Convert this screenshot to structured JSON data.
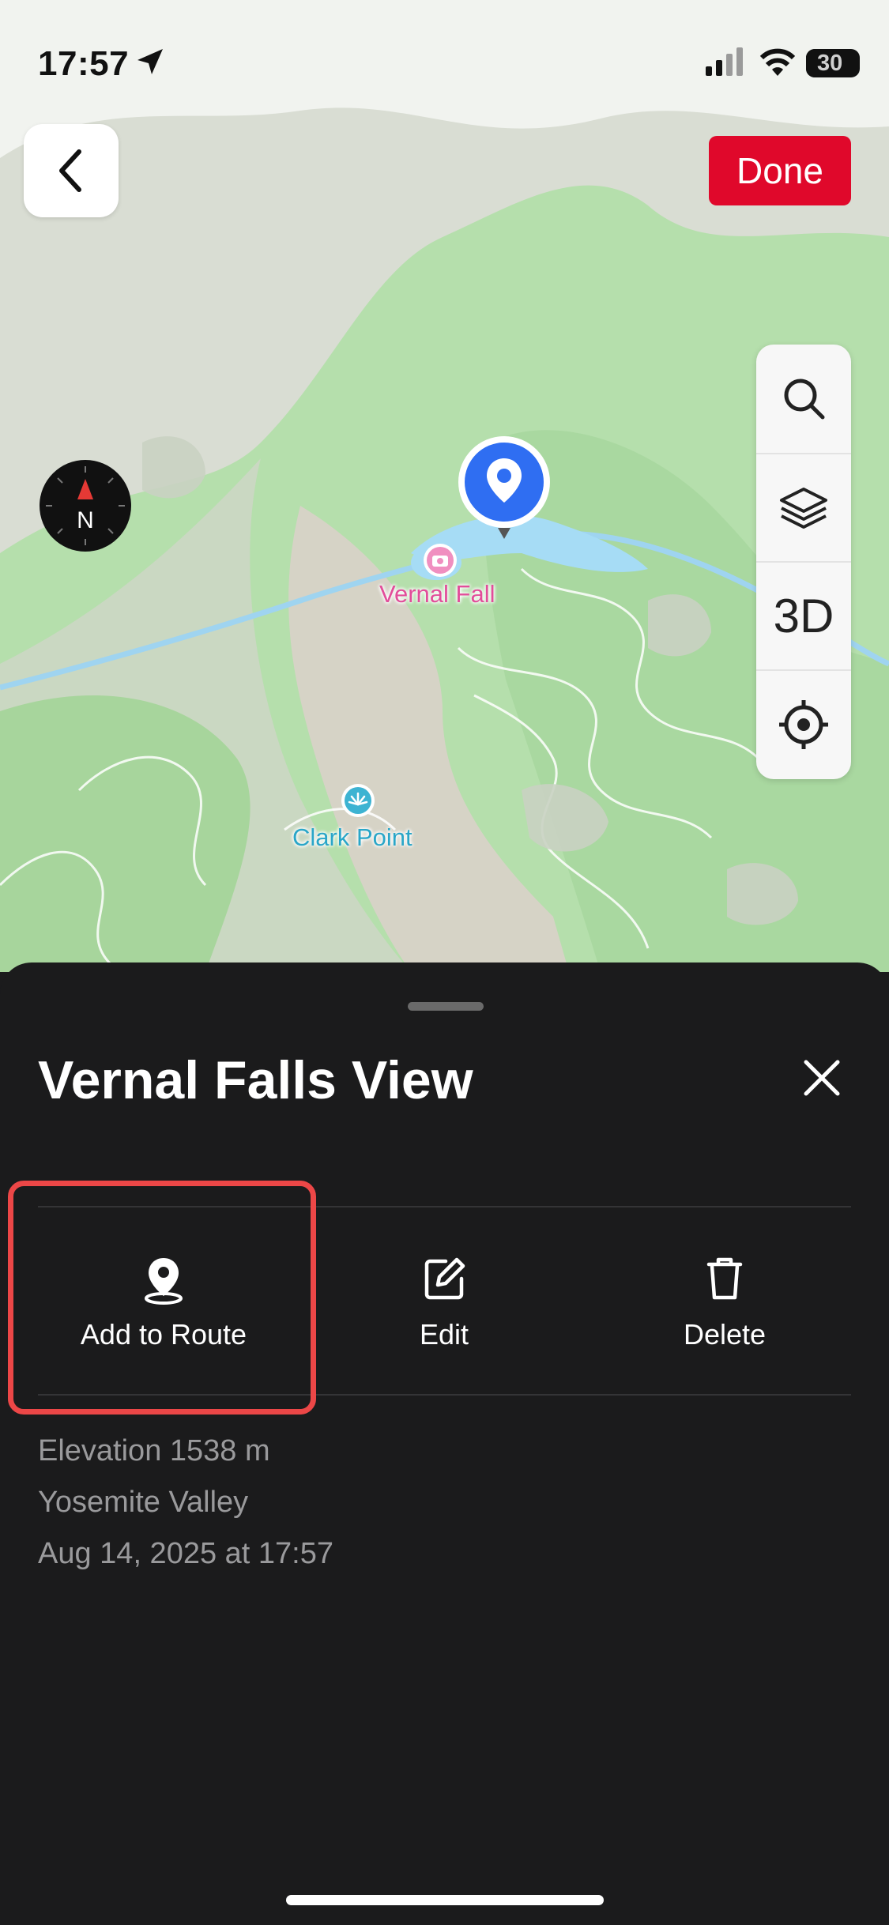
{
  "status_bar": {
    "time": "17:57",
    "battery": "30"
  },
  "top_controls": {
    "done_label": "Done"
  },
  "map": {
    "places": [
      {
        "name": "Vernal Fall",
        "color": "#e24d9a"
      },
      {
        "name": "Clark Point",
        "color": "#2aa6c8"
      }
    ],
    "compass_label": "N",
    "tools": {
      "mode_3d_label": "3D"
    }
  },
  "sheet": {
    "title": "Vernal Falls View",
    "actions": [
      {
        "label": "Add to Route",
        "icon": "pin-icon"
      },
      {
        "label": "Edit",
        "icon": "edit-icon"
      },
      {
        "label": "Delete",
        "icon": "trash-icon"
      }
    ],
    "details": {
      "elevation": "Elevation 1538 m",
      "region": "Yosemite Valley",
      "date": "Aug 14, 2025 at 17:57"
    }
  },
  "colors": {
    "accent": "#e0082b",
    "marker": "#2f6ef2",
    "highlight": "#ec4747",
    "sheet_bg": "#1b1b1c"
  }
}
